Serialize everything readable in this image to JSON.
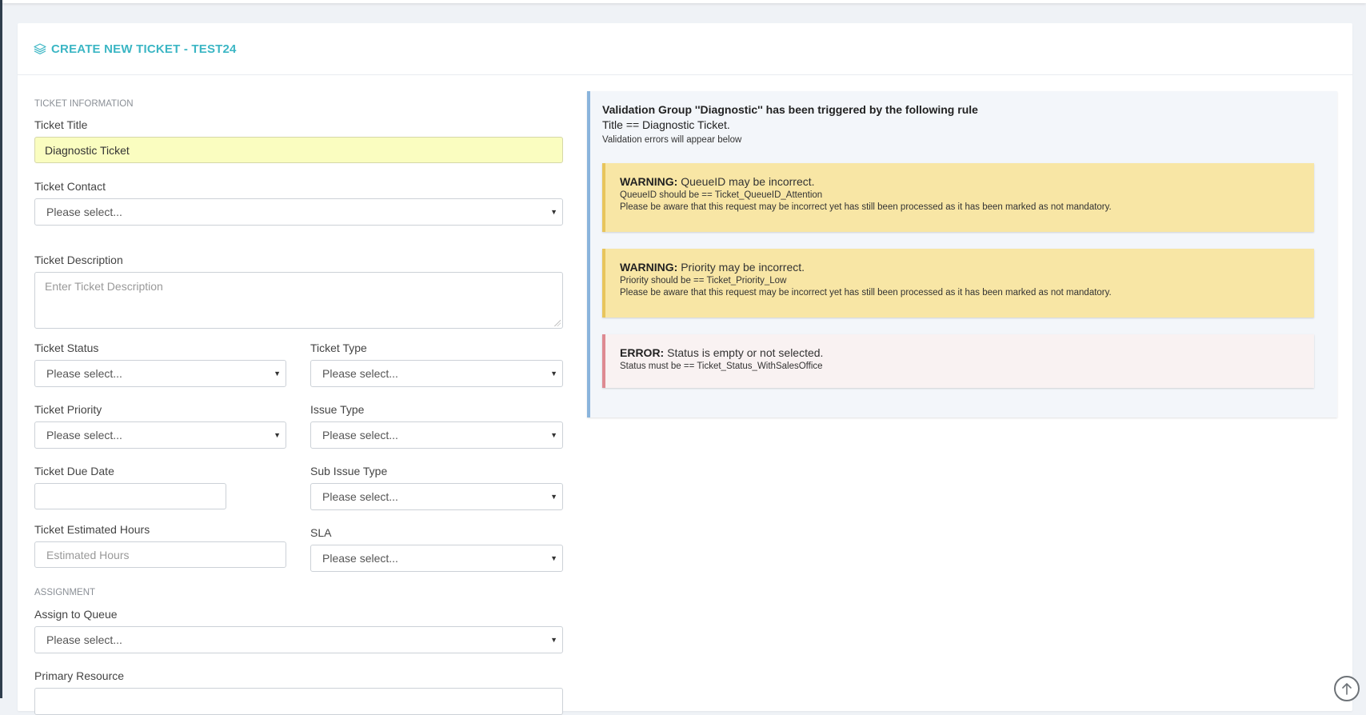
{
  "header": {
    "title": "CREATE NEW TICKET - TEST24",
    "icon": "layers-icon",
    "accent_color": "#3bb6c4"
  },
  "form": {
    "section_info": "TICKET INFORMATION",
    "title_label": "Ticket Title",
    "title_value": "Diagnostic Ticket",
    "contact_label": "Ticket Contact",
    "contact_value": "Please select...",
    "description_label": "Ticket Description",
    "description_placeholder": "Enter Ticket Description",
    "status_label": "Ticket Status",
    "status_value": "Please select...",
    "type_label": "Ticket Type",
    "type_value": "Please select...",
    "priority_label": "Ticket Priority",
    "priority_value": "Please select...",
    "issue_type_label": "Issue Type",
    "issue_type_value": "Please select...",
    "due_date_label": "Ticket Due Date",
    "due_date_value": "",
    "sub_issue_label": "Sub Issue Type",
    "sub_issue_value": "Please select...",
    "est_hours_label": "Ticket Estimated Hours",
    "est_hours_placeholder": "Estimated Hours",
    "sla_label": "SLA",
    "sla_value": "Please select...",
    "section_assignment": "ASSIGNMENT",
    "queue_label": "Assign to Queue",
    "queue_value": "Please select...",
    "resource_label": "Primary Resource"
  },
  "validation": {
    "heading": "Validation Group ''Diagnostic'' has been triggered by the following rule",
    "rule": "Title == Diagnostic Ticket.",
    "note": "Validation errors will appear below",
    "alerts": [
      {
        "kind": "WARNING:",
        "message": "QueueID may be incorrect.",
        "detail": "QueueID should be == Ticket_QueueID_Attention",
        "info": "Please be aware that this request may be incorrect yet has still been processed as it has been marked as not mandatory."
      },
      {
        "kind": "WARNING:",
        "message": "Priority may be incorrect.",
        "detail": "Priority should be == Ticket_Priority_Low",
        "info": "Please be aware that this request may be incorrect yet has still been processed as it has been marked as not mandatory."
      },
      {
        "kind": "ERROR:",
        "message": "Status is empty or not selected.",
        "detail": "Status must be == Ticket_Status_WithSalesOffice"
      }
    ],
    "warning_color": "#f8e6a5",
    "error_color": "#f9f2f2"
  },
  "controls": {
    "scroll_top_icon": "arrow-up-circle-icon"
  }
}
